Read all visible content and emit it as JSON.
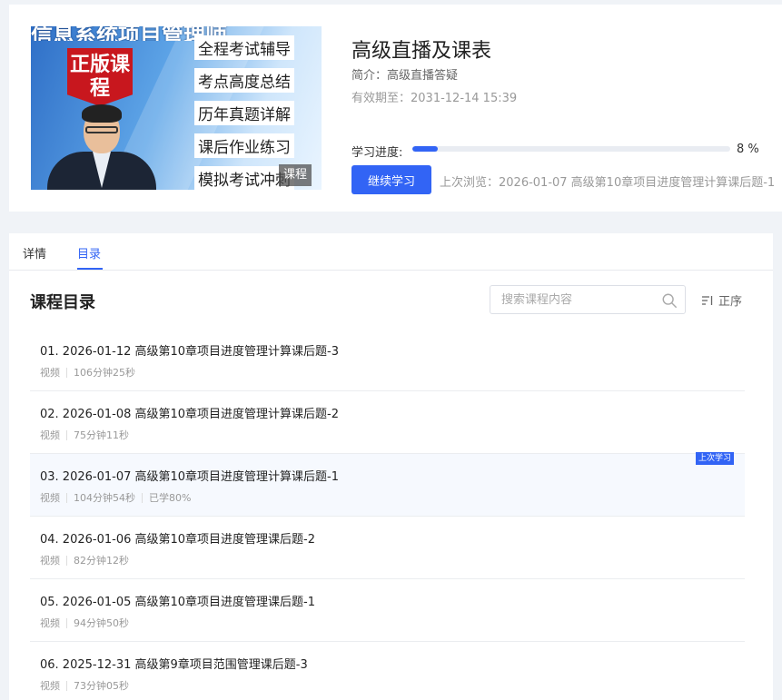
{
  "course": {
    "cover": {
      "top_text": "信息系统项目管理师",
      "badge": "正版课程",
      "features": [
        "全程考试辅导",
        "考点高度总结",
        "历年真题详解",
        "课后作业练习",
        "模拟考试冲刺"
      ],
      "corner_tag": "课程"
    },
    "title": "高级直播及课表",
    "intro": "简介：高级直播答疑",
    "expire": "有效期至：2031-12-14 15:39",
    "progress_label": "学习进度:",
    "progress_value": 8,
    "progress_text": "8 %",
    "continue_label": "继续学习",
    "last_view": "上次浏览：2026-01-07 高级第10章项目进度管理计算课后题-1"
  },
  "tabs": [
    {
      "label": "详情",
      "active": false
    },
    {
      "label": "目录",
      "active": true
    }
  ],
  "catalog": {
    "title": "课程目录",
    "search_placeholder": "搜索课程内容",
    "sort_label": "正序"
  },
  "lessons": [
    {
      "title": "01.  2026-01-12 高级第10章项目进度管理计算课后题-3",
      "type": "视频",
      "duration": "106分钟25秒",
      "studied": "",
      "last": ""
    },
    {
      "title": "02.  2026-01-08 高级第10章项目进度管理计算课后题-2",
      "type": "视频",
      "duration": "75分钟11秒",
      "studied": "",
      "last": ""
    },
    {
      "title": "03.  2026-01-07 高级第10章项目进度管理计算课后题-1",
      "type": "视频",
      "duration": "104分钟54秒",
      "studied": "已学80%",
      "last": "上次学习"
    },
    {
      "title": "04.  2026-01-06 高级第10章项目进度管理课后题-2",
      "type": "视频",
      "duration": "82分钟12秒",
      "studied": "",
      "last": ""
    },
    {
      "title": "05.  2026-01-05 高级第10章项目进度管理课后题-1",
      "type": "视频",
      "duration": "94分钟50秒",
      "studied": "",
      "last": ""
    },
    {
      "title": "06.  2025-12-31 高级第9章项目范围管理课后题-3",
      "type": "视频",
      "duration": "73分钟05秒",
      "studied": "",
      "last": ""
    }
  ],
  "colors": {
    "accent": "#3264f5",
    "page_bg": "#f0f3f7"
  }
}
